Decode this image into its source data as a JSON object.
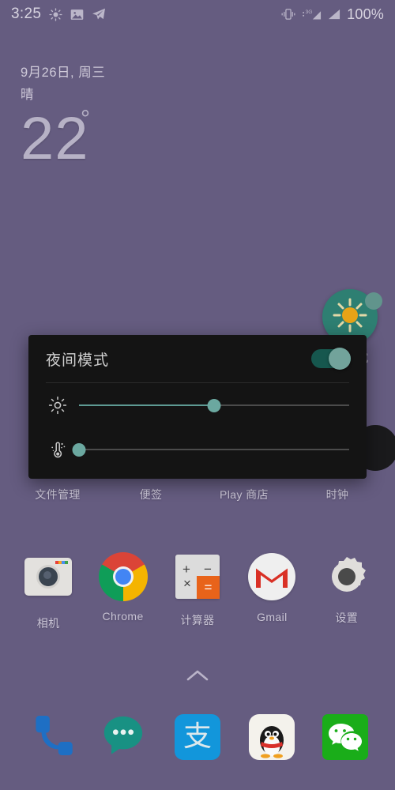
{
  "statusbar": {
    "time": "3:25",
    "battery": "100%",
    "network_label": "3G",
    "left_icons": [
      "brightness-sun-icon",
      "photo-icon",
      "telegram-plane-icon"
    ],
    "right_icons": [
      "vibrate-icon",
      "signal-3g-icon",
      "signal-icon"
    ]
  },
  "weather": {
    "date": "9月26日, 周三",
    "condition": "晴",
    "temperature": "22",
    "degree_symbol": "°"
  },
  "floating_button": {
    "name": "night-mode-sun-toggle",
    "color": "#2E7F72",
    "sun_color": "#E8A317"
  },
  "home": {
    "hidden_row": [
      {
        "label": "文件管理",
        "icon": "file-manager-icon"
      },
      {
        "label": "便签",
        "icon": "notes-icon"
      },
      {
        "label": "Play 商店",
        "icon": "play-store-icon"
      },
      {
        "label": "时钟",
        "icon": "clock-icon"
      }
    ],
    "main_row": [
      {
        "label": "相机",
        "icon": "camera-icon"
      },
      {
        "label": "Chrome",
        "icon": "chrome-icon"
      },
      {
        "label": "计算器",
        "icon": "calculator-icon"
      },
      {
        "label": "Gmail",
        "icon": "gmail-icon"
      },
      {
        "label": "设置",
        "icon": "settings-gear-icon"
      }
    ],
    "peek_label": "式",
    "drawer_indicator": "chevron-up-icon"
  },
  "dock": [
    {
      "name": "phone-app",
      "icon": "phone-handset-icon",
      "color": "#1E6FC4"
    },
    {
      "name": "messages-app",
      "icon": "message-bubble-icon",
      "color": "#189183"
    },
    {
      "name": "alipay-app",
      "icon": "alipay-icon",
      "glyph": "支",
      "color": "#1296DB"
    },
    {
      "name": "qq-app",
      "icon": "qq-penguin-icon",
      "color": "#F4F2EC"
    },
    {
      "name": "wechat-app",
      "icon": "wechat-icon",
      "color": "#1AAD19"
    }
  ],
  "night_dialog": {
    "title": "夜间模式",
    "enabled": true,
    "accent_color": "#6BA8A0",
    "background": "#141414",
    "brightness": {
      "icon": "brightness-sun-icon",
      "value": 50,
      "min": 0,
      "max": 100
    },
    "color_temperature": {
      "icon": "color-temperature-icon",
      "value": 0,
      "min": 0,
      "max": 100
    }
  }
}
